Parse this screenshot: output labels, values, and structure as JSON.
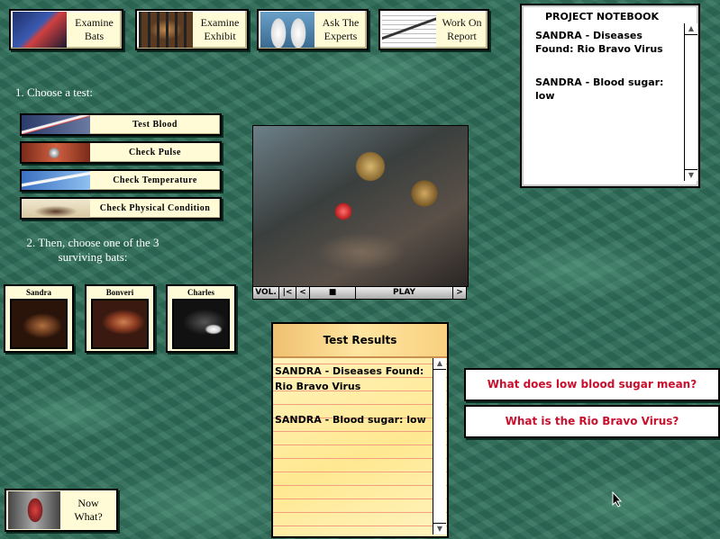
{
  "nav": [
    {
      "label_line1": "Examine",
      "label_line2": "Bats",
      "icon": "stethoscope-icon"
    },
    {
      "label_line1": "Examine",
      "label_line2": "Exhibit",
      "icon": "caged-bat-icon"
    },
    {
      "label_line1": "Ask The",
      "label_line2": "Experts",
      "icon": "scientists-icon"
    },
    {
      "label_line1": "Work On",
      "label_line2": "Report",
      "icon": "notebook-pen-icon"
    }
  ],
  "step1": "1. Choose a test:",
  "tests": [
    {
      "label": "Test Blood",
      "icon": "syringe-icon"
    },
    {
      "label": "Check Pulse",
      "icon": "stopwatch-icon"
    },
    {
      "label": "Check Temperature",
      "icon": "thermometer-icon"
    },
    {
      "label": "Check Physical Condition",
      "icon": "bat-icon"
    }
  ],
  "step2_line1": "2. Then, choose one of the 3",
  "step2_line2": "surviving bats:",
  "bats": [
    {
      "name": "Sandra"
    },
    {
      "name": "Bonveri"
    },
    {
      "name": "Charles"
    }
  ],
  "video_controls": {
    "vol": "VOL.",
    "start": "|<",
    "back": "<",
    "stop": "■",
    "play": "PLAY",
    "fwd": ">"
  },
  "notebook": {
    "title": "PROJECT NOTEBOOK",
    "entry1": "SANDRA - Diseases Found: Rio Bravo Virus",
    "entry2": "SANDRA - Blood sugar: low"
  },
  "results": {
    "title": "Test Results",
    "entry1": "SANDRA - Diseases Found: Rio Bravo Virus",
    "entry2": "SANDRA - Blood sugar: low"
  },
  "questions": [
    "What does low blood sugar mean?",
    "What is the Rio Bravo Virus?"
  ],
  "nowwhat": {
    "line1": "Now",
    "line2": "What?",
    "icon": "question-can-icon"
  }
}
